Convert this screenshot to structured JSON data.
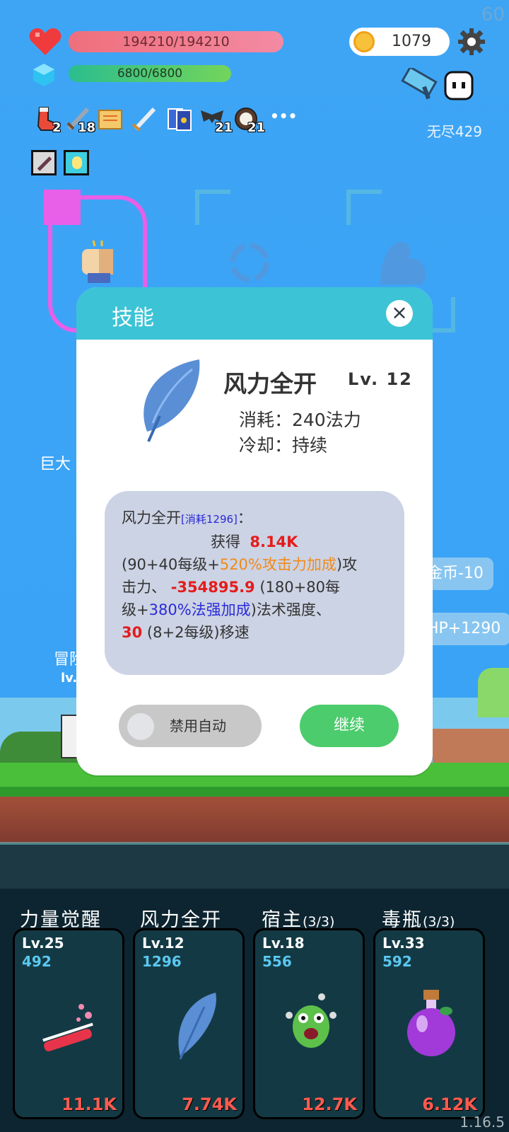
{
  "hud": {
    "fps": "60",
    "hp": "194210/194210",
    "mp": "6800/6800",
    "coins": "1079",
    "endless_label": "无尽429"
  },
  "items": [
    {
      "name": "sock-icon",
      "count": "2"
    },
    {
      "name": "sword-icon",
      "count": "18"
    },
    {
      "name": "scroll-icon",
      "count": ""
    },
    {
      "name": "silver-sword-icon",
      "count": ""
    },
    {
      "name": "cards-icon",
      "count": ""
    },
    {
      "name": "bat-icon",
      "count": "21"
    },
    {
      "name": "coconut-icon",
      "count": "21"
    }
  ],
  "more_label": "•••",
  "background_text": {
    "left_label": "巨大",
    "hero_name": "冒险",
    "hero_lv": "lv.",
    "coin_pill": "金币-10",
    "hp_pill": "HP+1290"
  },
  "dialog": {
    "title": "技能",
    "close": "×",
    "skill_name": "风力全开",
    "skill_level": "Lv. 12",
    "cost": "消耗：240法力",
    "cooldown": "冷却：持续",
    "desc": {
      "name": "风力全开",
      "cost_tag": "[消耗1296]",
      "colon": "：",
      "gain_prefix": "获得",
      "gain_value": "8.14K",
      "line2_a": "(90+40每级+",
      "line2_orange": "520%攻击力加成",
      "line2_b": ")攻",
      "line3_a": "击力、",
      "line3_red": "-354895.9",
      "line3_b": "(180+80每",
      "line4_a": "级+",
      "line4_blue": "380%法强加成",
      "line4_b": ")法术强度、",
      "line5_red": "30",
      "line5_b": "(8+2每级)移速"
    },
    "toggle_label": "禁用自动",
    "continue_label": "继续"
  },
  "skill_cards": [
    {
      "title": "力量觉醒",
      "suffix": "",
      "level": "Lv.25",
      "cost": "492",
      "damage": "11.1K",
      "icon": "potion-tube-icon"
    },
    {
      "title": "风力全开",
      "suffix": "",
      "level": "Lv.12",
      "cost": "1296",
      "damage": "7.74K",
      "icon": "feather-icon"
    },
    {
      "title": "宿主",
      "suffix": "(3/3)",
      "level": "Lv.18",
      "cost": "556",
      "damage": "12.7K",
      "icon": "monster-icon"
    },
    {
      "title": "毒瓶",
      "suffix": "(3/3)",
      "level": "Lv.33",
      "cost": "592",
      "damage": "6.12K",
      "icon": "poison-bottle-icon"
    }
  ],
  "version": "1.16.5",
  "colors": {
    "sky": "#3ea5f5",
    "dialog_header": "#3cc3d6",
    "continue": "#4ccc6c",
    "damage": "#ff5a4e"
  }
}
